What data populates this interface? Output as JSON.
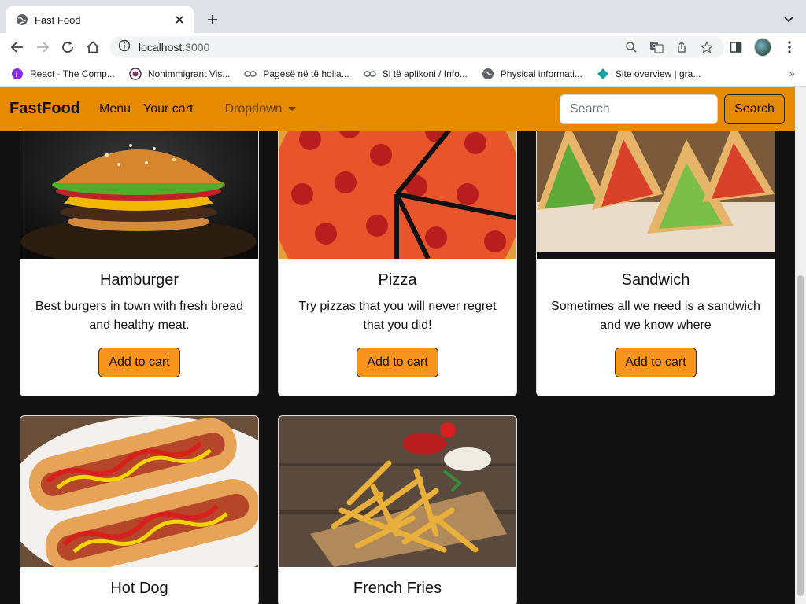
{
  "browser": {
    "tab_title": "Fast Food",
    "url_host": "localhost",
    "url_port": ":3000",
    "bookmarks": [
      {
        "label": "React - The Comp...",
        "icon": "react-icon"
      },
      {
        "label": "Nonimmigrant Vis...",
        "icon": "seal-icon"
      },
      {
        "label": "Pagesë në të holla...",
        "icon": "link-icon"
      },
      {
        "label": "Si të aplikoni / Info...",
        "icon": "link-icon"
      },
      {
        "label": "Physical informati...",
        "icon": "globe-icon"
      },
      {
        "label": "Site overview | gra...",
        "icon": "diamond-icon"
      }
    ]
  },
  "navbar": {
    "brand": "FastFood",
    "menu": "Menu",
    "cart": "Your cart",
    "dropdown": "Dropdown",
    "search_placeholder": "Search",
    "search_button": "Search"
  },
  "colors": {
    "navbar_bg": "#e68a00",
    "button_bg": "#f7941d",
    "page_bg": "#121212"
  },
  "products": [
    {
      "name": "Hamburger",
      "description": "Best burgers in town with fresh bread and healthy meat.",
      "button": "Add to cart"
    },
    {
      "name": "Pizza",
      "description": "Try pizzas that you will never regret that you did!",
      "button": "Add to cart"
    },
    {
      "name": "Sandwich",
      "description": "Sometimes all we need is a sandwich and we know where",
      "button": "Add to cart"
    },
    {
      "name": "Hot Dog"
    },
    {
      "name": "French Fries"
    }
  ]
}
